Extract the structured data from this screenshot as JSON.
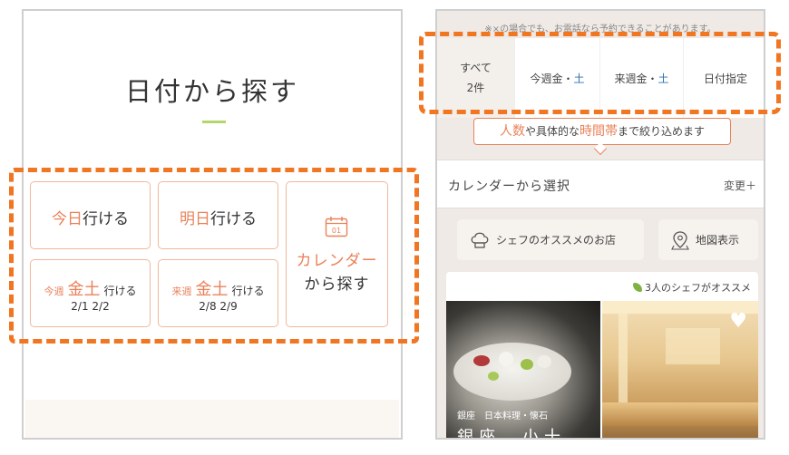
{
  "left": {
    "title": "日付から探す",
    "today": {
      "accent": "今日",
      "rest": "行ける"
    },
    "tomorrow": {
      "accent": "明日",
      "rest": "行ける"
    },
    "this_week": {
      "prefix": "今週",
      "main": "金土",
      "suffix": "行ける",
      "dates": "2/1 2/2"
    },
    "next_week": {
      "prefix": "来週",
      "main": "金土",
      "suffix": "行ける",
      "dates": "2/8 2/9"
    },
    "calendar": {
      "line1": "カレンダー",
      "line2": "から探す",
      "icon_text": "01"
    }
  },
  "right": {
    "note": "※×の場合でも、お電話なら予約できることがあります。",
    "tabs": {
      "all": {
        "label": "すべて",
        "count": "2件"
      },
      "this_week": {
        "prefix": "今週金・",
        "accent": "土"
      },
      "next_week": {
        "prefix": "来週金・",
        "accent": "土"
      },
      "specify": {
        "label": "日付指定"
      }
    },
    "banner": {
      "hl1": "人数",
      "t1": "や具体的な",
      "hl2": "時間帯",
      "t2": "まで絞り込めます"
    },
    "calendar_row": {
      "label": "カレンダーから選択",
      "change": "変更＋"
    },
    "pills": {
      "chef": "シェフのオススメのお店",
      "map": "地図表示"
    },
    "card": {
      "recommend": "3人のシェフがオススメ",
      "area": "銀座",
      "genre": "日本料理・懐石",
      "name": "銀座　小十"
    }
  },
  "colors": {
    "accent": "#e9825a",
    "highlight_dash": "#f07622",
    "title_rule": "#b5d66a",
    "tab_blue": "#2b6fb5",
    "leaf_green": "#7cb342"
  },
  "icons": {
    "calendar": "calendar-icon",
    "chef": "chef-hat-icon",
    "map": "map-pin-icon",
    "recommend": "leaf-icon",
    "favorite": "heart-icon"
  }
}
